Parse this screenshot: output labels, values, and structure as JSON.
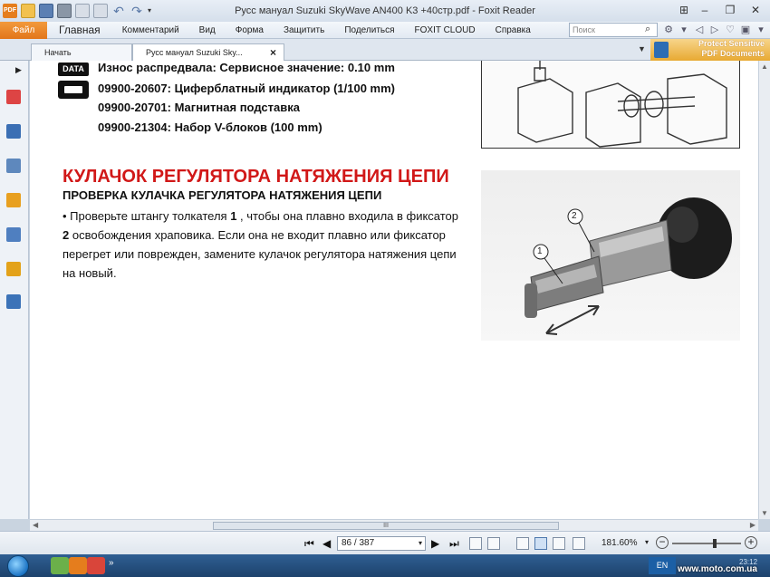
{
  "window": {
    "title": "Русс манyал Suzuki SkyWave AN400 K3 +40стр.pdf - Foxit Reader",
    "app_icon_label": "PDF"
  },
  "menu": {
    "file": "Файл",
    "items": [
      "Главная",
      "Комментарий",
      "Вид",
      "Форма",
      "Защитить",
      "Поделиться",
      "FOXIT CLOUD",
      "Справка"
    ],
    "search_placeholder": "Поиск"
  },
  "tabs": {
    "items": [
      {
        "label": "Начать",
        "active": false
      },
      {
        "label": "Русс манyал Suzuki Sky...",
        "active": true
      }
    ],
    "close_glyph": "×"
  },
  "promo": {
    "line1": "Protect Sensitive",
    "line2": "PDF Documents"
  },
  "document": {
    "data_badge": "DATA",
    "specs": [
      "Износ распредвала: Сервисное значение: 0.10 mm",
      "09900-20607: Циферблатный индикатор (1/100 mm)",
      "09900-20701: Магнитная подставка",
      "09900-21304: Набор V-блоков (100 mm)"
    ],
    "red_heading": "КУЛАЧОК РЕГУЛЯТОРА НАТЯЖЕНИЯ ЦЕПИ",
    "sub_heading": "ПРОВЕРКА КУЛАЧКА РЕГУЛЯТОРА НАТЯЖЕНИЯ ЦЕПИ",
    "body": {
      "l1_a": "• Проверьте штангу толкателя ",
      "l1_b": "1",
      "l1_c": " , чтобы она плавно входила в фиксатор",
      "l2_a": "2",
      "l2_b": " освобождения храповика. Если она не входит плавно или фиксатор",
      "l3": "перегрет или поврежден, замените кулачок регулятора натяжения цепи",
      "l4": "на новый."
    },
    "callouts": [
      "1",
      "2"
    ]
  },
  "scrollbar": {
    "thumb_grip": "III"
  },
  "status": {
    "page": "86 / 387",
    "zoom": "181.60%",
    "zoom_level": 0.62
  },
  "taskbar": {
    "lang": "EN",
    "url": "www.moto.com.ua",
    "clock": "23:12"
  },
  "colors": {
    "accent_orange": "#e57d1d",
    "heading_red": "#d11818"
  }
}
